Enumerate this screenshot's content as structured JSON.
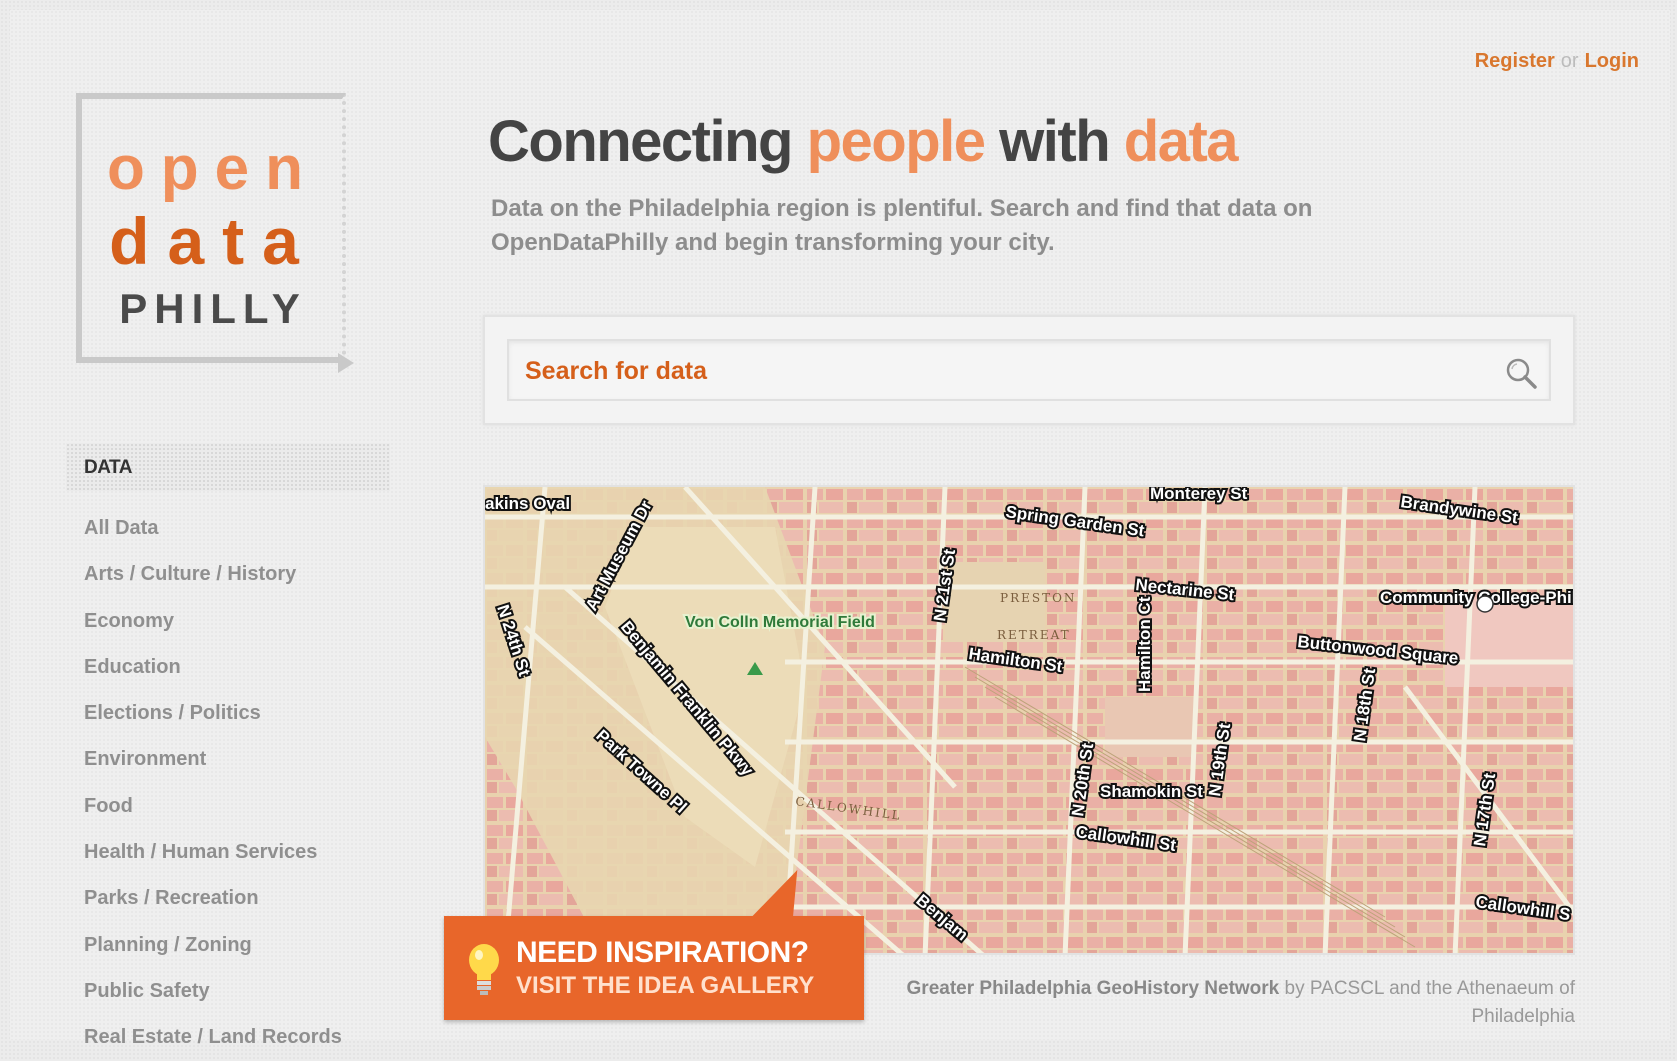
{
  "auth": {
    "register": "Register",
    "or": "or",
    "login": "Login"
  },
  "logo": {
    "line1": "open",
    "line2": "data",
    "line3": "PHILLY"
  },
  "sidebar": {
    "heading": "DATA",
    "items": [
      "All Data",
      "Arts / Culture / History",
      "Economy",
      "Education",
      "Elections / Politics",
      "Environment",
      "Food",
      "Health / Human Services",
      "Parks / Recreation",
      "Planning / Zoning",
      "Public Safety",
      "Real Estate / Land Records"
    ]
  },
  "hero": {
    "title_1": "Connecting",
    "title_2": "people",
    "title_3": "with",
    "title_4": "data",
    "subtitle": "Data on the Philadelphia region is plentiful. Search and find that data on OpenDataPhilly and begin transforming your city."
  },
  "search": {
    "placeholder": "Search for data"
  },
  "map": {
    "labels": {
      "spring_garden": "Spring Garden St",
      "brandywine": "Brandywine St",
      "monterey": "Monterey St",
      "nectarine": "Nectarine St",
      "hamilton": "Hamilton St",
      "hamilton_ct": "Hamilton Ct",
      "buttonwood": "Buttonwood Square",
      "community_college": "Community College-Philadelphia",
      "von_colln": "Von Colln Memorial Field",
      "art_museum": "Art Museum Dr",
      "n24th": "N 24th St",
      "n21st": "N 21st St",
      "n20th": "N 20th St",
      "n19th": "N 19th St",
      "n18th": "N 18th St",
      "n17th": "N 17th St",
      "ben_franklin": "Benjamin Franklin Pkwy",
      "park_towne": "Park Towne Pl",
      "shamokin": "Shamokin St",
      "callowhill": "Callowhill St",
      "callowhill_e": "Callowhill S",
      "benjamin_lower": "Benjam",
      "eakins": "akins Oval",
      "preston": "PRESTON",
      "retreat": "RETREAT",
      "callowhill_old": "CALLOWHILL"
    }
  },
  "inspire": {
    "line1": "NEED INSPIRATION?",
    "line2": "VISIT THE IDEA GALLERY"
  },
  "credit": {
    "source": "Greater Philadelphia GeoHistory Network",
    "rest": "by PACSCL and the Athenaeum of Philadelphia"
  },
  "colors": {
    "accent": "#d55f1a",
    "accent_light": "#ef8f5b",
    "button": "#e8662a"
  }
}
